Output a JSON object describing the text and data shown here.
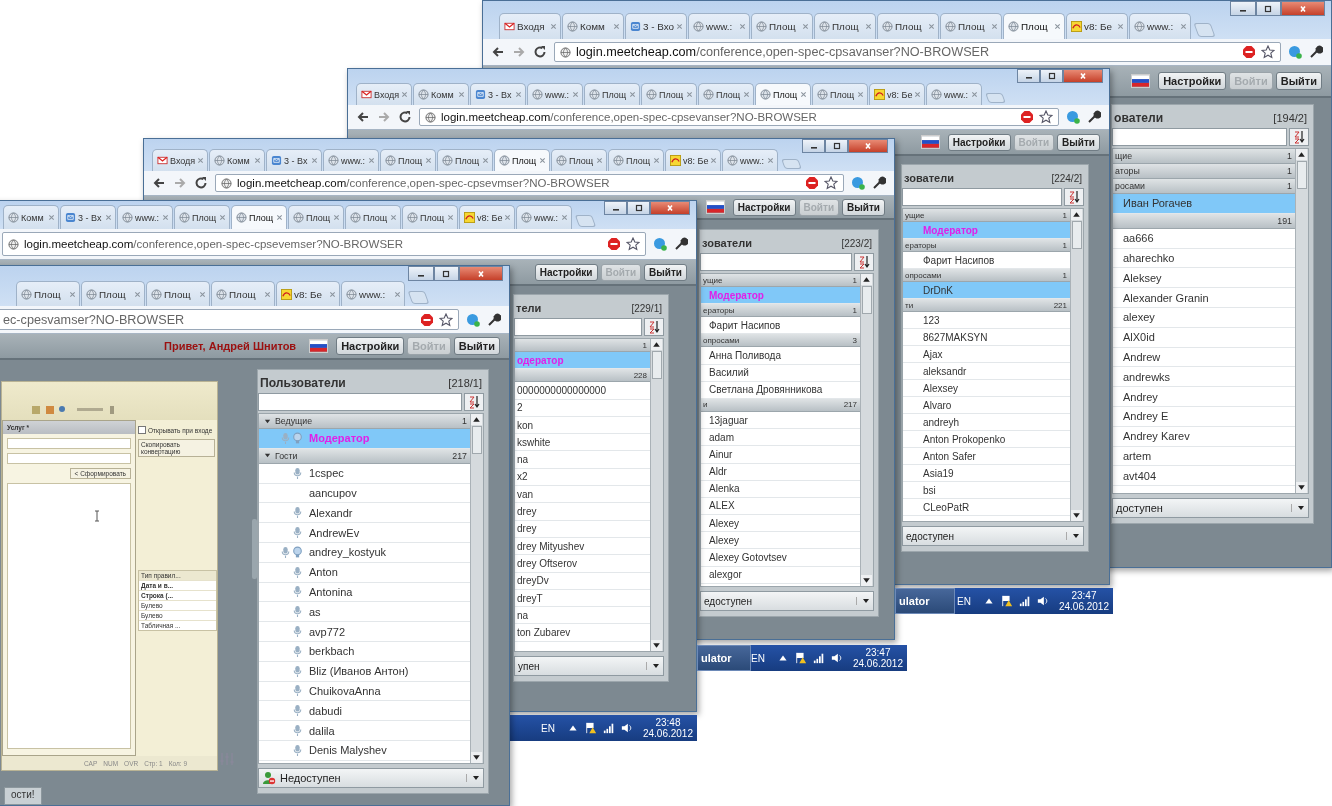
{
  "windows": [
    {
      "tabs": [
        {
          "label": "Входя",
          "kind": "gmail",
          "selected": false
        },
        {
          "label": "Комм",
          "kind": "globe",
          "selected": false
        },
        {
          "label": "3 - Вхо",
          "kind": "mail",
          "selected": false
        },
        {
          "label": "www.:",
          "kind": "globe",
          "selected": false
        },
        {
          "label": "Площ",
          "kind": "globe",
          "selected": false
        },
        {
          "label": "Площ",
          "kind": "globe",
          "selected": false
        },
        {
          "label": "Площ",
          "kind": "globe",
          "selected": false
        },
        {
          "label": "Площ",
          "kind": "globe",
          "selected": false
        },
        {
          "label": "Площ",
          "kind": "globe",
          "selected": true
        },
        {
          "label": "v8: Бе",
          "kind": "v8",
          "selected": false
        },
        {
          "label": "www.:",
          "kind": "globe",
          "selected": false
        }
      ],
      "address": {
        "host": "login.meetcheap.com",
        "path": "/conference,open-spec-cpsavanser?NO-BROWSER"
      },
      "buttons": [
        {
          "label": "Настройки",
          "disabled": false
        },
        {
          "label": "Войти",
          "disabled": true
        },
        {
          "label": "Выйти",
          "disabled": false
        }
      ],
      "users_panel": {
        "title": "ователи",
        "count": "[194/2]",
        "groups": [
          {
            "label": "щие",
            "count": "1"
          },
          {
            "label": "аторы",
            "count": "1"
          },
          {
            "label": "росами",
            "count": "1",
            "rows": [
              {
                "name": "Иван Рогачев",
                "selected": true
              }
            ]
          },
          {
            "count": "191",
            "rows": [
              {
                "name": "aa666",
                "selected": false
              },
              {
                "name": "aharechko",
                "selected": false
              },
              {
                "name": "Aleksey",
                "selected": false
              },
              {
                "name": "Alexander Granin",
                "selected": false
              },
              {
                "name": "alexey",
                "selected": false
              },
              {
                "name": "AlX0id",
                "selected": false
              },
              {
                "name": "Andrew",
                "selected": false
              },
              {
                "name": "andrewks",
                "selected": false
              },
              {
                "name": "Andrey",
                "selected": false
              },
              {
                "name": "Andrey E",
                "selected": false
              },
              {
                "name": "Andrey Karev",
                "selected": false
              },
              {
                "name": "artem",
                "selected": false
              },
              {
                "name": "avt404",
                "selected": false
              }
            ]
          }
        ],
        "status": "доступен"
      }
    },
    {
      "tabs": [
        {
          "label": "Входя",
          "kind": "gmail",
          "selected": false
        },
        {
          "label": "Комм",
          "kind": "globe",
          "selected": false
        },
        {
          "label": "3 - Вх",
          "kind": "mail",
          "selected": false
        },
        {
          "label": "www.:",
          "kind": "globe",
          "selected": false
        },
        {
          "label": "Площ",
          "kind": "globe",
          "selected": false
        },
        {
          "label": "Площ",
          "kind": "globe",
          "selected": false
        },
        {
          "label": "Площ",
          "kind": "globe",
          "selected": false
        },
        {
          "label": "Площ",
          "kind": "globe",
          "selected": true
        },
        {
          "label": "Площ",
          "kind": "globe",
          "selected": false
        },
        {
          "label": "v8: Бе",
          "kind": "v8",
          "selected": false
        },
        {
          "label": "www.:",
          "kind": "globe",
          "selected": false
        }
      ],
      "address": {
        "host": "login.meetcheap.com",
        "path": "/conference,open-spec-cpsevanser?NO-BROWSER"
      },
      "buttons": [
        {
          "label": "Настройки",
          "disabled": false
        },
        {
          "label": "Войти",
          "disabled": true
        },
        {
          "label": "Выйти",
          "disabled": false
        }
      ],
      "users_panel": {
        "title": "зователи",
        "count": "[224/2]",
        "groups": [
          {
            "label": "ущие",
            "count": "1",
            "rows": [
              {
                "name": "Модератор",
                "kind": "moderator",
                "selected": true
              }
            ]
          },
          {
            "label": "ераторы",
            "count": "1",
            "rows": [
              {
                "name": "Фарит Насипов",
                "selected": false
              }
            ]
          },
          {
            "label": "опросами",
            "count": "1",
            "rows": [
              {
                "name": "DrDnK",
                "selected": true
              }
            ]
          },
          {
            "label": "ти",
            "count": "221",
            "rows": [
              {
                "name": "123",
                "selected": false
              },
              {
                "name": "8627MAKSYN",
                "selected": false
              },
              {
                "name": "Ajax",
                "selected": false
              },
              {
                "name": "aleksandr",
                "selected": false
              },
              {
                "name": "Alexsey",
                "selected": false
              },
              {
                "name": "Alvaro",
                "selected": false
              },
              {
                "name": "andreyh",
                "selected": false
              },
              {
                "name": "Anton Prokopenko",
                "selected": false
              },
              {
                "name": "Anton Safer",
                "selected": false
              },
              {
                "name": "Asia19",
                "selected": false
              },
              {
                "name": "bsi",
                "selected": false
              },
              {
                "name": "CLeoPatR",
                "selected": false
              }
            ]
          }
        ],
        "status": "едоступен"
      }
    },
    {
      "tabs": [
        {
          "label": "Входя",
          "kind": "gmail",
          "selected": false
        },
        {
          "label": "Комм",
          "kind": "globe",
          "selected": false
        },
        {
          "label": "3 - Вх",
          "kind": "mail",
          "selected": false
        },
        {
          "label": "www.:",
          "kind": "globe",
          "selected": false
        },
        {
          "label": "Площ",
          "kind": "globe",
          "selected": false
        },
        {
          "label": "Площ",
          "kind": "globe",
          "selected": false
        },
        {
          "label": "Площ",
          "kind": "globe",
          "selected": true
        },
        {
          "label": "Площ",
          "kind": "globe",
          "selected": false
        },
        {
          "label": "Площ",
          "kind": "globe",
          "selected": false
        },
        {
          "label": "v8: Бе",
          "kind": "v8",
          "selected": false
        },
        {
          "label": "www.:",
          "kind": "globe",
          "selected": false
        }
      ],
      "address": {
        "host": "login.meetcheap.com",
        "path": "/conference,open-spec-cpsevmser?NO-BROWSER"
      },
      "buttons": [
        {
          "label": "Настройки",
          "disabled": false
        },
        {
          "label": "Войти",
          "disabled": true
        },
        {
          "label": "Выйти",
          "disabled": false
        }
      ],
      "users_panel": {
        "title": "зователи",
        "count": "[223/2]",
        "groups": [
          {
            "label": "ущие",
            "count": "1",
            "rows": [
              {
                "name": "Модератор",
                "kind": "moderator",
                "selected": true
              }
            ]
          },
          {
            "label": "ераторы",
            "count": "1",
            "rows": [
              {
                "name": "Фарит Насипов",
                "selected": false
              }
            ]
          },
          {
            "label": "опросами",
            "count": "3",
            "rows": [
              {
                "name": "Анна Поливода",
                "selected": false
              },
              {
                "name": "Василий",
                "selected": false
              },
              {
                "name": "Светлана Дровянникова",
                "selected": false
              }
            ]
          },
          {
            "label": "и",
            "count": "217",
            "rows": [
              {
                "name": "13jaguar",
                "selected": false
              },
              {
                "name": "adam",
                "selected": false
              },
              {
                "name": "Ainur",
                "selected": false
              },
              {
                "name": "Aldr",
                "selected": false
              },
              {
                "name": "Alenka",
                "selected": false
              },
              {
                "name": "ALEX",
                "selected": false
              },
              {
                "name": "Alexey",
                "selected": false
              },
              {
                "name": "Alexey",
                "selected": false
              },
              {
                "name": "Alexey Gotovtsev",
                "selected": false
              },
              {
                "name": "alexgor",
                "selected": false
              }
            ]
          }
        ],
        "status": "едоступен"
      }
    },
    {
      "tabs": [
        {
          "label": "Комм",
          "kind": "globe",
          "selected": false
        },
        {
          "label": "3 - Вх",
          "kind": "mail",
          "selected": false
        },
        {
          "label": "www.:",
          "kind": "globe",
          "selected": false
        },
        {
          "label": "Площ",
          "kind": "globe",
          "selected": false
        },
        {
          "label": "Площ",
          "kind": "globe",
          "selected": true
        },
        {
          "label": "Площ",
          "kind": "globe",
          "selected": false
        },
        {
          "label": "Площ",
          "kind": "globe",
          "selected": false
        },
        {
          "label": "Площ",
          "kind": "globe",
          "selected": false
        },
        {
          "label": "v8: Бе",
          "kind": "v8",
          "selected": false
        },
        {
          "label": "www.:",
          "kind": "globe",
          "selected": false
        }
      ],
      "address": {
        "host": "login.meetcheap.com",
        "path": "/conference,open-spec-cpsevemser?NO-BROWSER"
      },
      "buttons": [
        {
          "label": "Настройки",
          "disabled": false
        },
        {
          "label": "Войти",
          "disabled": true
        },
        {
          "label": "Выйти",
          "disabled": false
        }
      ],
      "users_panel": {
        "title": "тели",
        "count": "[229/1]",
        "groups": [
          {
            "count": "1",
            "rows": [
              {
                "name": "одератор",
                "kind": "moderator",
                "selected": true
              }
            ]
          },
          {
            "count": "228",
            "rows": [
              {
                "name": "0000000000000000",
                "selected": false
              },
              {
                "name": "2",
                "selected": false
              },
              {
                "name": "kon",
                "selected": false
              },
              {
                "name": "kswhite",
                "selected": false
              },
              {
                "name": "na",
                "selected": false
              },
              {
                "name": "x2",
                "selected": false
              },
              {
                "name": "van",
                "selected": false
              },
              {
                "name": "drey",
                "selected": false
              },
              {
                "name": "drey",
                "selected": false
              },
              {
                "name": "drey Mityushev",
                "selected": false
              },
              {
                "name": "drey Oftserov",
                "selected": false
              },
              {
                "name": "dreyDv",
                "selected": false
              },
              {
                "name": "dreyT",
                "selected": false
              },
              {
                "name": "na",
                "selected": false
              },
              {
                "name": "ton Zubarev",
                "selected": false
              }
            ]
          }
        ],
        "status": "упен"
      }
    },
    {
      "tabs": [
        {
          "label": "Площ",
          "kind": "globe",
          "selected": false
        },
        {
          "label": "Площ",
          "kind": "globe",
          "selected": false
        },
        {
          "label": "Площ",
          "kind": "globe",
          "selected": false
        },
        {
          "label": "Площ",
          "kind": "globe",
          "selected": false
        },
        {
          "label": "v8: Бе",
          "kind": "v8",
          "selected": false
        },
        {
          "label": "www.:",
          "kind": "globe",
          "selected": false
        }
      ],
      "address": {
        "path": "ec-cpesvamser?NO-BROWSER"
      },
      "greeting": "Привет, Андрей Шнитов",
      "buttons": [
        {
          "label": "Настройки",
          "disabled": false
        },
        {
          "label": "Войти",
          "disabled": true
        },
        {
          "label": "Выйти",
          "disabled": false
        }
      ],
      "embedded_app": {
        "title": "Услуг *",
        "checkbox": {
          "label": "Открывать при входе",
          "checked": false
        },
        "copy_button": "Скопировать конвертацию",
        "build_button": "< Сформировать",
        "column": "Тип правил...",
        "cells": [
          "Дата и в...",
          "Строка (...",
          "Булево",
          "Булево",
          "Табличная ..."
        ],
        "status": [
          "CAP",
          "NUM",
          "OVR",
          "Стр: 1",
          "Кол: 9"
        ]
      },
      "users_panel": {
        "title": "Пользователи",
        "count": "[218/1]",
        "groups": [
          {
            "label": "Ведущие",
            "count": "1",
            "expanded": true,
            "rows": [
              {
                "name": "Модератор",
                "kind": "moderator",
                "selected": true,
                "mic": true,
                "hand": true
              }
            ]
          },
          {
            "label": "Гости",
            "count": "217",
            "expanded": true,
            "rows": [
              {
                "name": "1cspec",
                "selected": false,
                "mic": true,
                "hand": false
              },
              {
                "name": "aancupov",
                "selected": false,
                "mic": false,
                "hand": false
              },
              {
                "name": "Alexandr",
                "selected": false,
                "mic": true,
                "hand": false
              },
              {
                "name": "AndrewEv",
                "selected": false,
                "mic": true,
                "hand": false
              },
              {
                "name": "andrey_kostyuk",
                "selected": false,
                "mic": true,
                "hand": true
              },
              {
                "name": "Anton",
                "selected": false,
                "mic": true,
                "hand": false
              },
              {
                "name": "Antonina",
                "selected": false,
                "mic": true,
                "hand": false
              },
              {
                "name": "as",
                "selected": false,
                "mic": true,
                "hand": false
              },
              {
                "name": "avp772",
                "selected": false,
                "mic": true,
                "hand": false
              },
              {
                "name": "berkbach",
                "selected": false,
                "mic": true,
                "hand": false
              },
              {
                "name": "Bliz (Иванов Антон)",
                "selected": false,
                "mic": true,
                "hand": false
              },
              {
                "name": "ChuikovaAnna",
                "selected": false,
                "mic": true,
                "hand": false
              },
              {
                "name": "dabudi",
                "selected": false,
                "mic": true,
                "hand": false
              },
              {
                "name": "dalila",
                "selected": false,
                "mic": true,
                "hand": false
              },
              {
                "name": "Denis Malyshev",
                "selected": false,
                "mic": true,
                "hand": false
              }
            ]
          }
        ],
        "status": "Недоступен",
        "status_icon": true
      },
      "bottom_button": "ости!"
    }
  ],
  "taskbars": [
    {
      "app": "ulator",
      "lang": "EN",
      "time": "23:47",
      "date": "24.06.2012"
    },
    {
      "app": "ulator",
      "lang": "EN",
      "time": "23:47",
      "date": "24.06.2012"
    },
    {
      "lang": "EN",
      "time": "23:48",
      "date": "24.06.2012"
    }
  ]
}
